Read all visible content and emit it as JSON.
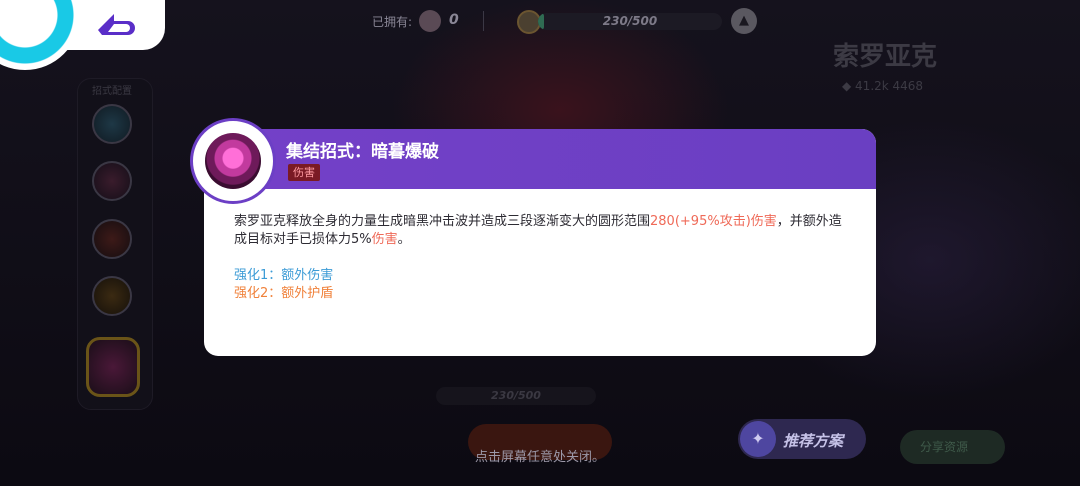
{
  "top_bar": {
    "owned_label": "已拥有:",
    "owned_count": "0",
    "xp_text": "230/500",
    "xp_progress": 0.03
  },
  "hero": {
    "name": "索罗亚克",
    "subtitle": "◆ 41.2k 4468"
  },
  "skill_rail": {
    "title": "招式配置"
  },
  "modal": {
    "title": "集结招式：暗暮爆破",
    "tag": "伤害",
    "desc_part1": "索罗亚克释放全身的力量生成暗黑冲击波并造成三段逐渐变大的圆形范围",
    "desc_highlight1": "280(+95%攻击)伤害",
    "desc_part2": "，并额外造成目标对手已损体力5%",
    "desc_highlight2": "伤害",
    "desc_part3": "。",
    "enhance1": "强化1：额外伤害",
    "enhance2": "强化2：额外护盾"
  },
  "bottom": {
    "hint": "点击屏幕任意处关闭。",
    "recommend_label": "推荐方案",
    "share_label": "分享资源",
    "mid_bar_text": "230/500"
  },
  "colors": {
    "header_purple": "#7440c8",
    "damage_red": "#ef6a58",
    "enhance_blue": "#3b9bd6",
    "enhance_orange": "#f0813a"
  }
}
